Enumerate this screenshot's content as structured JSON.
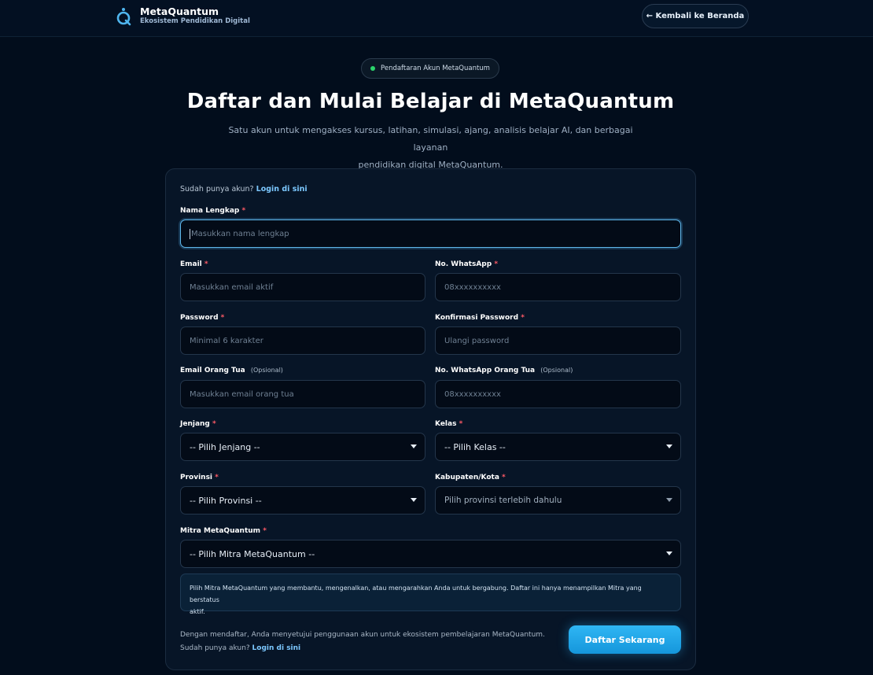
{
  "brand": {
    "name": "MetaQuantum",
    "tagline": "Ekosistem Pendidikan Digital"
  },
  "header": {
    "back_label": "← Kembali ke Beranda"
  },
  "hero": {
    "badge": "Pendaftaran Akun MetaQuantum",
    "title": "Daftar dan Mulai Belajar di MetaQuantum",
    "subtitle_line1": "Satu akun untuk mengakses kursus, latihan, simulasi, ajang, analisis belajar AI, dan berbagai layanan",
    "subtitle_line2": "pendidikan digital MetaQuantum."
  },
  "form": {
    "have_account": "Sudah punya akun?",
    "login_link": "Login di sini",
    "required_mark": "*",
    "optional_mark": "(Opsional)",
    "nama": {
      "label": "Nama Lengkap",
      "placeholder": "Masukkan nama lengkap"
    },
    "email": {
      "label": "Email",
      "placeholder": "Masukkan email aktif"
    },
    "whatsapp": {
      "label": "No. WhatsApp",
      "placeholder": "08xxxxxxxxxx"
    },
    "password": {
      "label": "Password",
      "placeholder": "Minimal 6 karakter"
    },
    "confirm": {
      "label": "Konfirmasi Password",
      "placeholder": "Ulangi password"
    },
    "email_ortu": {
      "label": "Email Orang Tua",
      "placeholder": "Masukkan email orang tua"
    },
    "wa_ortu": {
      "label": "No. WhatsApp Orang Tua",
      "placeholder": "08xxxxxxxxxx"
    },
    "jenjang": {
      "label": "Jenjang",
      "value": "-- Pilih Jenjang --"
    },
    "kelas": {
      "label": "Kelas",
      "value": "-- Pilih Kelas --"
    },
    "provinsi": {
      "label": "Provinsi",
      "value": "-- Pilih Provinsi --"
    },
    "kabupaten": {
      "label": "Kabupaten/Kota",
      "value": "Pilih provinsi terlebih dahulu"
    },
    "mitra": {
      "label": "Mitra MetaQuantum",
      "value": "-- Pilih Mitra MetaQuantum --"
    },
    "mitra_info_line1": "Pilih Mitra MetaQuantum yang membantu, mengenalkan, atau mengarahkan Anda untuk bergabung. Daftar ini hanya menampilkan Mitra yang berstatus",
    "mitra_info_line2": "aktif.",
    "agreement": "Dengan mendaftar, Anda menyetujui penggunaan akun untuk ekosistem pembelajaran MetaQuantum.",
    "foot_have_account": "Sudah punya akun?",
    "foot_login_link": "Login di sini",
    "submit_label": "Daftar Sekarang"
  },
  "colors": {
    "accent": "#2fb6f4",
    "background": "#020d1c",
    "required": "#ff5a66",
    "link": "#7cc8ff",
    "status_dot": "#2bd46b"
  },
  "icons": {
    "logo": "quantum-q-logo",
    "select_arrow": "caret-down-icon"
  }
}
